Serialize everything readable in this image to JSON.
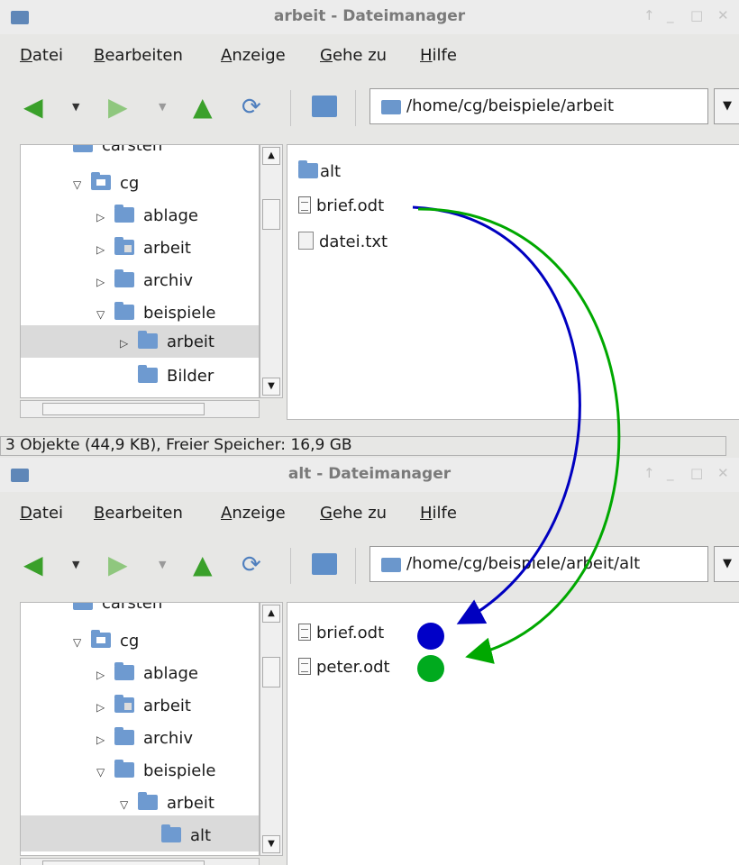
{
  "colors": {
    "blue_arrow": "#0000c0",
    "green_arrow": "#00a800",
    "folder": "#6e9ad0",
    "selection": "#dadada"
  },
  "windows": [
    {
      "title": "arbeit - Dateimanager",
      "menu": [
        {
          "ul": "D",
          "rest": "atei"
        },
        {
          "ul": "B",
          "rest": "earbeiten"
        },
        {
          "ul": "A",
          "rest": "nzeige"
        },
        {
          "ul": "G",
          "rest": "ehe zu"
        },
        {
          "ul": "H",
          "rest": "ilfe"
        }
      ],
      "path": "/home/cg/beispiele/arbeit",
      "tree": [
        "carsten",
        "cg",
        "ablage",
        "arbeit",
        "archiv",
        "beispiele",
        "arbeit",
        "Bilder"
      ],
      "files": [
        "alt",
        "brief.odt",
        "datei.txt"
      ],
      "status": "3 Objekte (44,9 KB), Freier Speicher: 16,9 GB"
    },
    {
      "title": "alt - Dateimanager",
      "menu": [
        {
          "ul": "D",
          "rest": "atei"
        },
        {
          "ul": "B",
          "rest": "earbeiten"
        },
        {
          "ul": "A",
          "rest": "nzeige"
        },
        {
          "ul": "G",
          "rest": "ehe zu"
        },
        {
          "ul": "H",
          "rest": "ilfe"
        }
      ],
      "path": "/home/cg/beispiele/arbeit/alt",
      "tree": [
        "carsten",
        "cg",
        "ablage",
        "arbeit",
        "archiv",
        "beispiele",
        "arbeit",
        "alt"
      ],
      "files": [
        "brief.odt",
        "peter.odt"
      ]
    }
  ],
  "icons": {
    "back": "go-back-icon",
    "forward": "go-forward-icon",
    "up": "go-up-icon",
    "reload": "reload-icon",
    "home": "home-folder-icon"
  }
}
